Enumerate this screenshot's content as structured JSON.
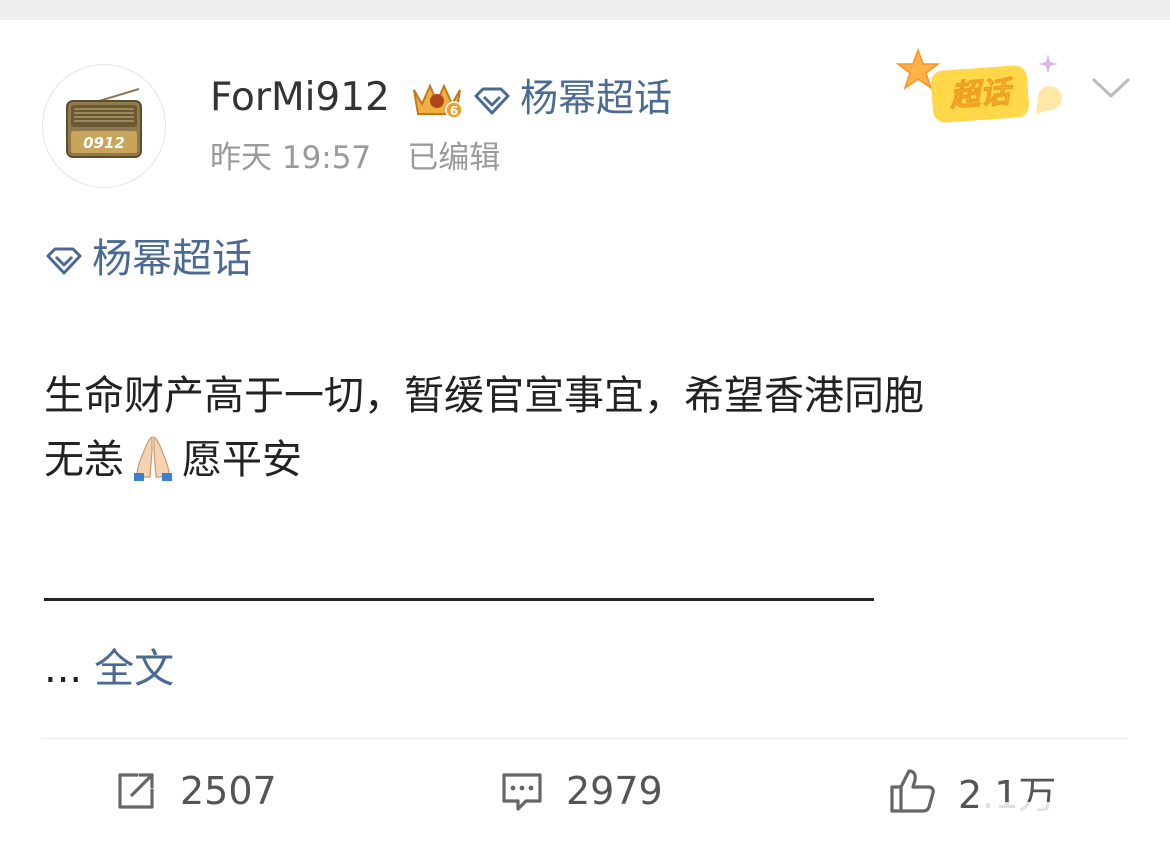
{
  "post": {
    "author": {
      "name": "ForMi912",
      "avatar_text": "0912",
      "level_badge": "6"
    },
    "header_topic": "杨幂超话",
    "timestamp": "昨天 19:57",
    "edited": "已编辑",
    "super_badge": "超话",
    "body_topic": "杨幂超话",
    "text_line1": "生命财产高于一切，暂缓官宣事宜，希望香港同胞",
    "text_line2a": "无恙",
    "text_line2b": "愿平安",
    "ellipsis": "...",
    "full_text_link": "全文"
  },
  "actions": {
    "repost_count": "2507",
    "comment_count": "2979",
    "like_count": "2.1万"
  },
  "colors": {
    "link": "#4a6a93",
    "muted": "#9a9a9a",
    "text": "#222222"
  },
  "icons": [
    "radio-avatar-icon",
    "crown-badge-icon",
    "diamond-topic-icon",
    "super-topic-badge-icon",
    "chevron-down-icon",
    "praying-hands-icon",
    "repost-icon",
    "comment-icon",
    "like-icon"
  ]
}
